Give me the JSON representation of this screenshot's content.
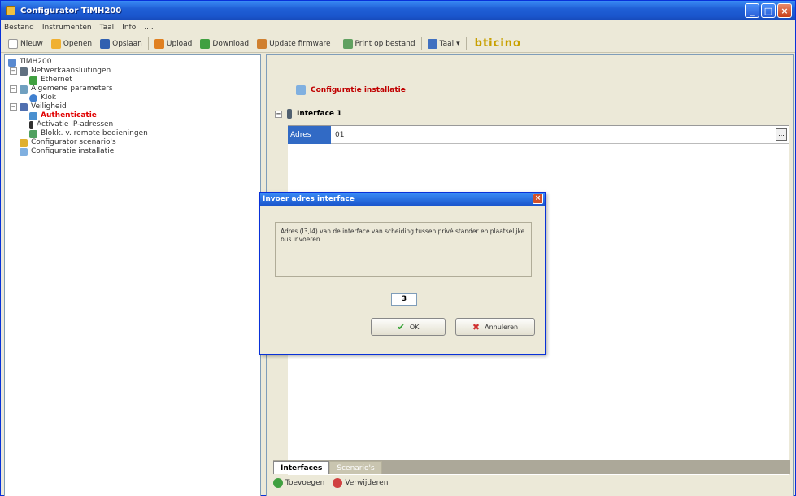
{
  "window": {
    "title": "Configurator TiMH200"
  },
  "menu": [
    "Bestand",
    "Instrumenten",
    "Taal",
    "Info",
    "...."
  ],
  "toolbar": {
    "new": "Nieuw",
    "open": "Openen",
    "save": "Opslaan",
    "upload": "Upload",
    "download": "Download",
    "update": "Update firmware",
    "print": "Print op bestand",
    "lang": "Taal",
    "brand": "bticino"
  },
  "tree": [
    "TiMH200",
    "Netwerkaansluitingen",
    "Ethernet",
    "Algemene parameters",
    "Klok",
    "Veiligheid",
    "Authenticatie",
    "Activatie IP-adressen",
    "Blokk. v. remote bedieningen",
    "Configurator scenario's",
    "Configuratie installatie"
  ],
  "right": {
    "section_title": "Configuratie installatie",
    "interface_title": "Interface 1",
    "row_label": "Adres",
    "row_value": "01",
    "ellipsis": "...",
    "tab_active": "Interfaces",
    "tab_inactive": "Scenario's",
    "add": "Toevoegen",
    "remove": "Verwijderen"
  },
  "dialog": {
    "title": "Invoer adres interface",
    "message": "Adres (I3,I4) van de interface van scheiding tussen privé stander en plaatselijke bus invoeren",
    "value": "3",
    "ok": "OK",
    "cancel": "Annuleren"
  }
}
